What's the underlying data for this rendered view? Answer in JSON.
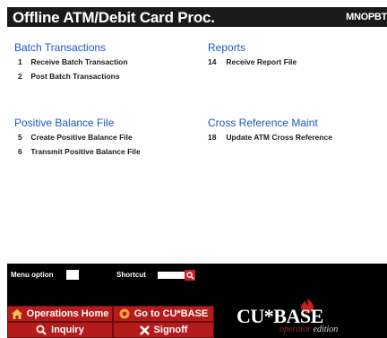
{
  "window": {
    "title": "Offline ATM/Debit Card Proc.",
    "code": "MNOPBT"
  },
  "sections": {
    "batch": {
      "heading": "Batch Transactions",
      "items": [
        {
          "num": "1",
          "label": "Receive Batch Transaction"
        },
        {
          "num": "2",
          "label": "Post Batch Transactions"
        }
      ]
    },
    "reports": {
      "heading": "Reports",
      "items": [
        {
          "num": "14",
          "label": "Receive Report File"
        }
      ]
    },
    "positive": {
      "heading": "Positive Balance File",
      "items": [
        {
          "num": "5",
          "label": "Create Positive Balance File"
        },
        {
          "num": "6",
          "label": "Transmit Positive Balance File"
        }
      ]
    },
    "crossref": {
      "heading": "Cross Reference Maint",
      "items": [
        {
          "num": "18",
          "label": "Update ATM Cross Reference"
        }
      ]
    }
  },
  "footer": {
    "menu_option_label": "Menu option",
    "shortcut_label": "Shortcut",
    "buttons": {
      "operations_home": "Operations Home",
      "go_to_cubase": "Go to CU*BASE",
      "inquiry": "Inquiry",
      "signoff": "Signoff"
    },
    "logo": {
      "brand": "CU*BASE",
      "edition_operator": "operator",
      "edition_word": "edition"
    }
  },
  "colors": {
    "accent_red": "#b51b1b",
    "heading_blue": "#1f56c4",
    "title_bar": "#1a1a1a"
  }
}
